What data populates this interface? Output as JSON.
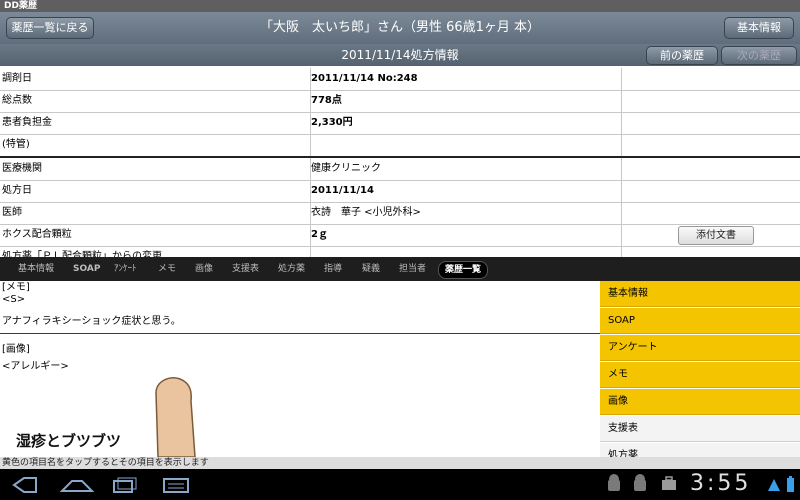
{
  "statusbar": {
    "app_name": "DD薬歴"
  },
  "header": {
    "back_label": "薬歴一覧に戻る",
    "title": "「大阪　太いち郎」さん（男性 66歳1ヶ月 本）",
    "info_label": "基本情報"
  },
  "subheader": {
    "title": "2011/11/14処方情報",
    "prev_label": "前の薬歴",
    "next_label": "次の薬歴"
  },
  "table": {
    "rows": [
      {
        "label": "調剤日",
        "value": "2011/11/14 No:248"
      },
      {
        "label": "総点数",
        "value": "778点"
      },
      {
        "label": "患者負担金",
        "value": "2,330円"
      },
      {
        "label": "(特管)",
        "value": ""
      },
      {
        "label": "医療機関",
        "value": "健康クリニック"
      },
      {
        "label": "処方日",
        "value": "2011/11/14"
      },
      {
        "label": "医師",
        "value": "衣詩　華子 <小児外科>"
      },
      {
        "label": "ホクス配合顆粒",
        "value": "2ｇ"
      },
      {
        "label": "処方薬「ＰＬ配合顆粒」からの変更",
        "value": ""
      }
    ],
    "attach_label": "添付文書"
  },
  "tabs": [
    "基本情報",
    "SOAP",
    "ｱﾝｹｰﾄ",
    "メモ",
    "画像",
    "支援表",
    "処方薬",
    "指導",
    "疑義",
    "担当者",
    "薬歴一覧"
  ],
  "tab_active": "薬歴一覧",
  "content": {
    "memo_header": "[メモ]",
    "s_label": "<S>",
    "s_text": "アナフィラキシーショック症状と思う。",
    "image_header": "[画像]",
    "allergy_label": "<アレルギー>",
    "image_caption": "湿疹とブツブツ"
  },
  "side_menu": [
    {
      "label": "基本情報",
      "highlight": true
    },
    {
      "label": "SOAP",
      "highlight": true
    },
    {
      "label": "アンケート",
      "highlight": true
    },
    {
      "label": "メモ",
      "highlight": true
    },
    {
      "label": "画像",
      "highlight": true
    },
    {
      "label": "支援表",
      "highlight": false
    },
    {
      "label": "処方薬",
      "highlight": false
    }
  ],
  "hint": "黄色の項目名をタップするとその項目を表示します",
  "clock": "3:55",
  "colors": {
    "highlight": "#f5c400",
    "header": "#6b7986",
    "red_rule": "#cc0000"
  }
}
